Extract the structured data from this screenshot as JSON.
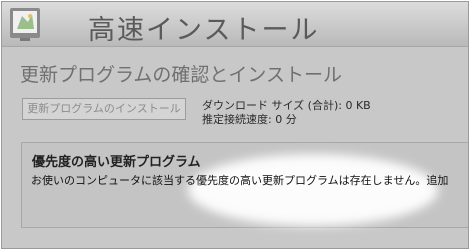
{
  "header": {
    "title": "高速インストール",
    "logo_icon": "windows-monitor-icon"
  },
  "page_title": "更新プログラムの確認とインストール",
  "install_button_label": "更新プログラムのインストール",
  "download": {
    "size_text": "ダウンロード サイズ (合計): 0 KB",
    "speed_text": "推定接続速度: 0 分"
  },
  "high_priority": {
    "title": "優先度の高い更新プログラム",
    "message": "お使いのコンピュータに該当する優先度の高い更新プログラムは存在しません。追加"
  },
  "colors": {
    "header_bg": "#c8c8c8",
    "spotlight": "#ffffff"
  }
}
